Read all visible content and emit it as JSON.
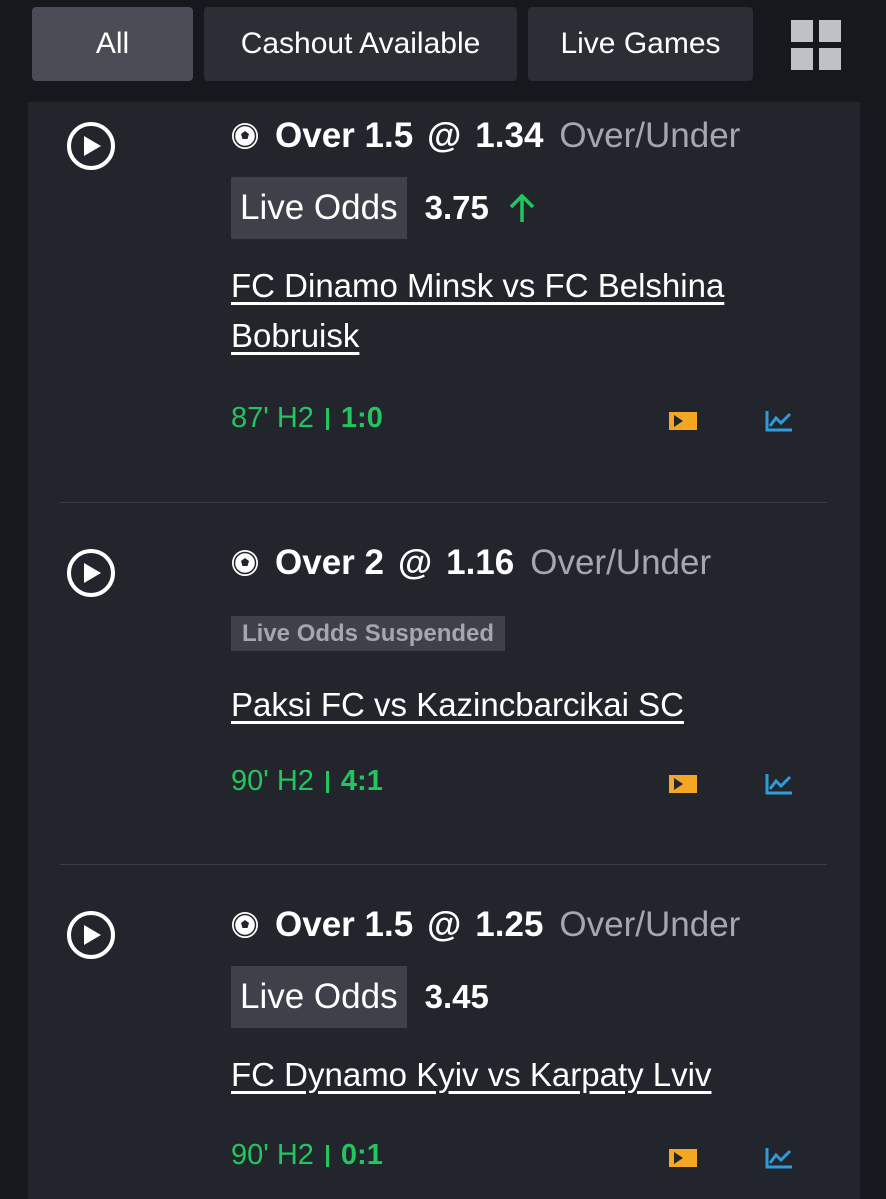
{
  "filters": {
    "all": "All",
    "cashout": "Cashout Available",
    "live": "Live Games"
  },
  "bets": [
    {
      "pick": "Over 1.5",
      "at": "@",
      "odds": "1.34",
      "market": "Over/Under",
      "live_label": "Live Odds",
      "live_value": "3.75",
      "trend": "up",
      "match": "FC Dinamo Minsk vs FC Belshina Bobruisk",
      "time": "87' H2",
      "score": "1:0"
    },
    {
      "pick": "Over 2",
      "at": "@",
      "odds": "1.16",
      "market": "Over/Under",
      "suspended_label": "Live Odds Suspended",
      "match": "Paksi FC vs Kazincbarcikai SC",
      "time": "90' H2",
      "score": "4:1"
    },
    {
      "pick": "Over 1.5",
      "at": "@",
      "odds": "1.25",
      "market": "Over/Under",
      "live_label": "Live Odds",
      "live_value": "3.45",
      "match": "FC Dynamo Kyiv vs Karpaty Lviv",
      "time": "90' H2",
      "score": "0:1"
    }
  ],
  "colors": {
    "live_green": "#22c55e",
    "stream_orange": "#f5a623",
    "stats_blue": "#2d9cdb"
  },
  "icons": [
    "grid-view-icon",
    "play-icon",
    "soccer-ball-icon",
    "arrow-up-icon",
    "live-stream-icon",
    "statistics-icon"
  ]
}
